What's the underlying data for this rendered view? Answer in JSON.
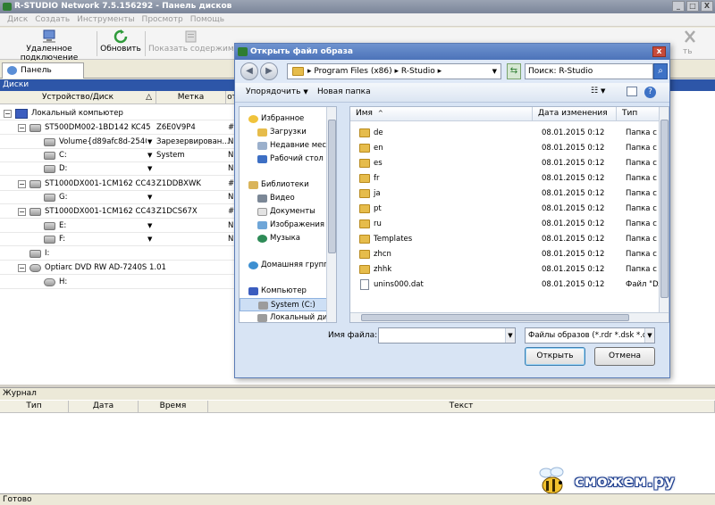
{
  "window": {
    "title": "R-STUDIO Network 7.5.156292 - Панель дисков",
    "minimize": "_",
    "maximize": "□",
    "close": "X"
  },
  "menu": [
    "Диск",
    "Создать",
    "Инструменты",
    "Просмотр",
    "Помощь"
  ],
  "toolbar": {
    "remote_connect": "Удаленное подключение",
    "refresh": "Обновить",
    "show_contents": "Показать содержимое",
    "right_partial": "ть"
  },
  "tabs": {
    "disk_panel": "Панель дисков"
  },
  "panel": {
    "title": "Диски"
  },
  "disk_columns": {
    "device": "Устройство/Диск",
    "mark": "Метка",
    "offset": "от"
  },
  "disk_tree": [
    {
      "label": "Локальный компьютер",
      "mark": "",
      "ofs": ""
    },
    {
      "label": "ST500DM002-1BD142 KC45",
      "mark": "Z6E0V9P4",
      "ofs": "#"
    },
    {
      "label": "Volume{d89afc8d-2540-1...",
      "mark": "Зарезервирован...",
      "ofs": "N"
    },
    {
      "label": "C:",
      "mark": "System",
      "ofs": "N"
    },
    {
      "label": "D:",
      "mark": "",
      "ofs": "N"
    },
    {
      "label": "ST1000DX001-1CM162 CC43",
      "mark": "Z1DDBXWK",
      "ofs": "#"
    },
    {
      "label": "G:",
      "mark": "",
      "ofs": "N"
    },
    {
      "label": "ST1000DX001-1CM162 CC43",
      "mark": "Z1DCS67X",
      "ofs": "#"
    },
    {
      "label": "E:",
      "mark": "",
      "ofs": "N"
    },
    {
      "label": "F:",
      "mark": "",
      "ofs": "N"
    },
    {
      "label": "I:",
      "mark": "",
      "ofs": ""
    },
    {
      "label": "Optiarc DVD RW AD-7240S 1.01",
      "mark": "",
      "ofs": ""
    },
    {
      "label": "H:",
      "mark": "",
      "ofs": ""
    }
  ],
  "journal": {
    "title": "Журнал",
    "columns": [
      "Тип",
      "Дата",
      "Время",
      "Текст"
    ]
  },
  "status": {
    "text": "Готово"
  },
  "watermark": {
    "text": "сможем.ру"
  },
  "dialog": {
    "title": "Открыть файл образа",
    "close": "x",
    "back": "◀",
    "forward": "▶",
    "address_parts": [
      "Program Files (x86)",
      "R-Studio"
    ],
    "search_placeholder": "Поиск: R-Studio",
    "organize": "Упорядочить",
    "new_folder": "Новая папка",
    "nav": [
      {
        "label": "Избранное",
        "icon": "star-icon"
      },
      {
        "label": "Загрузки",
        "icon": "downloads-icon"
      },
      {
        "label": "Недавние места",
        "icon": "recent-places-icon"
      },
      {
        "label": "Рабочий стол",
        "icon": "desktop-icon"
      },
      {
        "label": "Библиотеки",
        "icon": "libraries-icon"
      },
      {
        "label": "Видео",
        "icon": "video-icon"
      },
      {
        "label": "Документы",
        "icon": "documents-icon"
      },
      {
        "label": "Изображения",
        "icon": "pictures-icon"
      },
      {
        "label": "Музыка",
        "icon": "music-icon"
      },
      {
        "label": "Домашняя группа",
        "icon": "homegroup-icon"
      },
      {
        "label": "Компьютер",
        "icon": "computer-icon"
      },
      {
        "label": "System (C:)",
        "icon": "drive-icon"
      },
      {
        "label": "Локальный диск (",
        "icon": "drive-icon"
      }
    ],
    "file_columns": {
      "name": "Имя",
      "date": "Дата изменения",
      "type": "Тип"
    },
    "files": [
      {
        "name": "de",
        "date": "08.01.2015 0:12",
        "type": "Папка с фай"
      },
      {
        "name": "en",
        "date": "08.01.2015 0:12",
        "type": "Папка с фай"
      },
      {
        "name": "es",
        "date": "08.01.2015 0:12",
        "type": "Папка с фай"
      },
      {
        "name": "fr",
        "date": "08.01.2015 0:12",
        "type": "Папка с фай"
      },
      {
        "name": "ja",
        "date": "08.01.2015 0:12",
        "type": "Папка с фай"
      },
      {
        "name": "pt",
        "date": "08.01.2015 0:12",
        "type": "Папка с фай"
      },
      {
        "name": "ru",
        "date": "08.01.2015 0:12",
        "type": "Папка с фай"
      },
      {
        "name": "Templates",
        "date": "08.01.2015 0:12",
        "type": "Папка с фай"
      },
      {
        "name": "zhcn",
        "date": "08.01.2015 0:12",
        "type": "Папка с фай"
      },
      {
        "name": "zhhk",
        "date": "08.01.2015 0:12",
        "type": "Папка с фай"
      },
      {
        "name": "unins000.dat",
        "date": "08.01.2015 0:12",
        "type": "Файл \"DAT\""
      }
    ],
    "filename_label": "Имя файла:",
    "filename_value": "",
    "filter": "Файлы образов (*.rdr *.dsk *.d",
    "open_button": "Открыть",
    "cancel_button": "Отмена"
  }
}
